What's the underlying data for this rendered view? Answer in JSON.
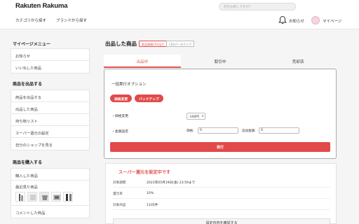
{
  "header": {
    "logo": "Rakuten Rakuma",
    "nav": [
      "カテゴリから探す",
      "ブランドから探す"
    ],
    "search_placeholder": "何をお探しですか？",
    "notifications_label": "お知らせ",
    "mypage_label": "マイページ"
  },
  "sidebar": {
    "mypage_menu_title": "マイページメニュー",
    "mypage_menu": [
      "お知らせ",
      "いいねした商品"
    ],
    "sell_title": "商品を出品する",
    "sell_menu": [
      "商品を出品する",
      "出品した商品",
      "持ち物リスト",
      "スーパー還元の設定",
      "自分のショップを見る"
    ],
    "buy_title": "商品を購入する",
    "buy_menu": [
      "購入した商品",
      "最近見た商品",
      "コメントした商品"
    ]
  },
  "main": {
    "page_title": "出品した商品",
    "tag_csv_export": "商品情報CSV出力",
    "tag_csv_clear": "CSVデータクリア",
    "tabs": [
      "出品中",
      "取引中",
      "売却済"
    ],
    "active_tab": "出品中",
    "bulk": {
      "title": "一括実行オプション",
      "price_change_button": "価格変更",
      "backup_button": "バックアップ",
      "price_change_label": "・価格変更",
      "price_select_value": "-100円",
      "amount_setting_label": "・金額設定",
      "price_input_label": "価格:",
      "price_input_value": "0",
      "add_amount_label": "追加金額:",
      "add_amount_value": "0",
      "execute_button": "実行"
    },
    "notice": {
      "title": "スーパー還元を設定中です",
      "rows": [
        {
          "label": "対象期間",
          "value": "2023年05月19日(金) 23:59まで"
        },
        {
          "label": "還元率",
          "value": "10%"
        },
        {
          "label": "対象商品",
          "value": "1105件"
        }
      ],
      "confirm_button": "設定内容を確認する"
    }
  },
  "colors": {
    "accent": "#e24a4a",
    "text": "#333333",
    "background": "#f5f5f5"
  }
}
